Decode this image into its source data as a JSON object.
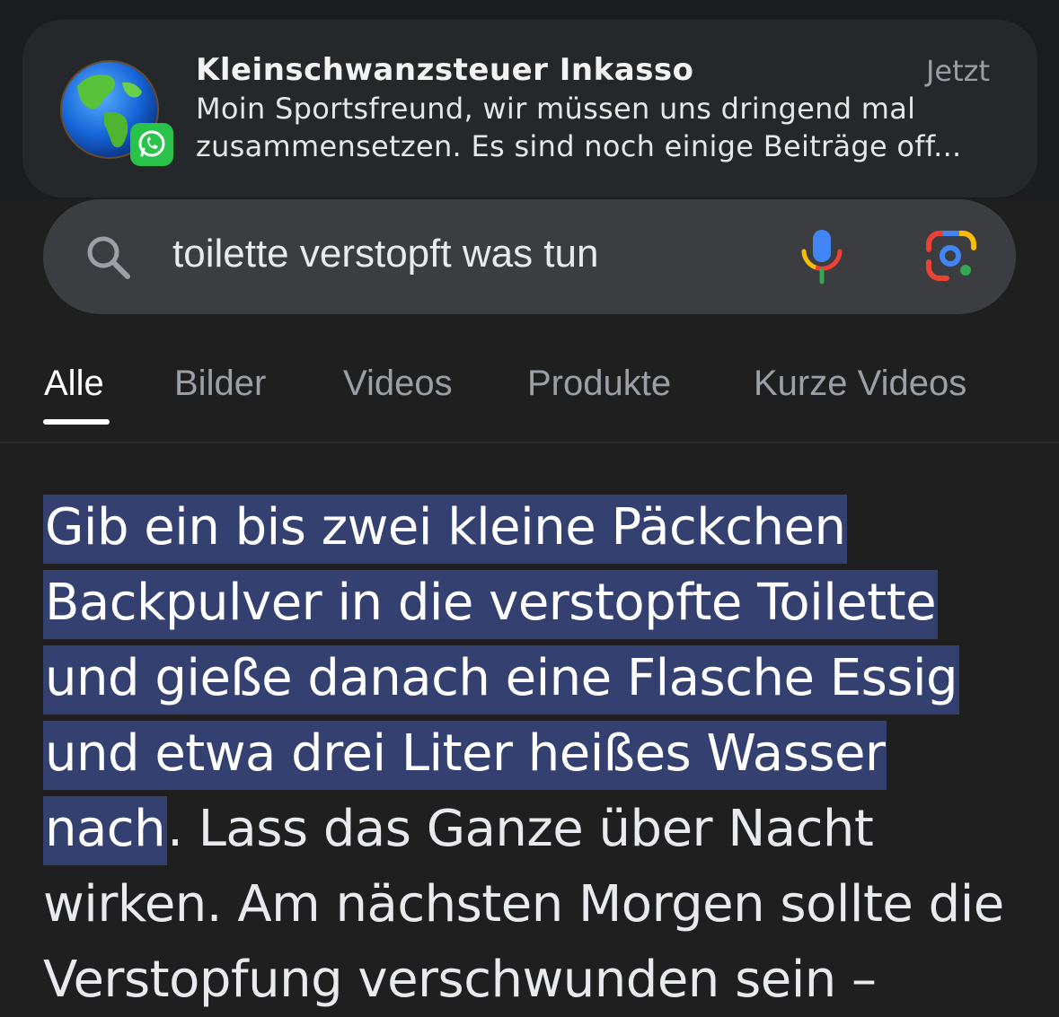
{
  "notification": {
    "app_icon": "globe-icon",
    "badge_icon": "whatsapp-icon",
    "sender": "Kleinschwanzsteuer Inkasso",
    "time": "Jetzt",
    "message_line1": "Moin Sportsfreund, wir müssen uns dringend mal",
    "message_line2": "zusammensetzen. Es sind noch einige Beiträge off..."
  },
  "search": {
    "query": "toilette verstopft was tun",
    "search_icon": "search-icon",
    "voice_icon": "microphone-icon",
    "lens_icon": "camera-lens-icon"
  },
  "tabs": [
    {
      "label": "Alle",
      "active": true
    },
    {
      "label": "Bilder",
      "active": false
    },
    {
      "label": "Videos",
      "active": false
    },
    {
      "label": "Produkte",
      "active": false
    },
    {
      "label": "Kurze Videos",
      "active": false
    }
  ],
  "answer": {
    "highlight_line1": "Gib ein bis zwei kleine Päckchen",
    "highlight_line2": "Backpulver in die verstopfte Toilette",
    "highlight_line3": "und gieße danach eine Flasche Essig",
    "highlight_line4": "und etwa drei Liter heißes Wasser",
    "highlight_line5": "nach",
    "line5_rest": ". Lass das Ganze über Nacht",
    "line6": "wirken. Am nächsten Morgen sollte die",
    "line7": "Verstopfung verschwunden sein –"
  },
  "colors": {
    "background": "#1f1f1f",
    "highlight": "#34406f",
    "search_bar": "#3b3d40",
    "notification": "#25282b"
  }
}
